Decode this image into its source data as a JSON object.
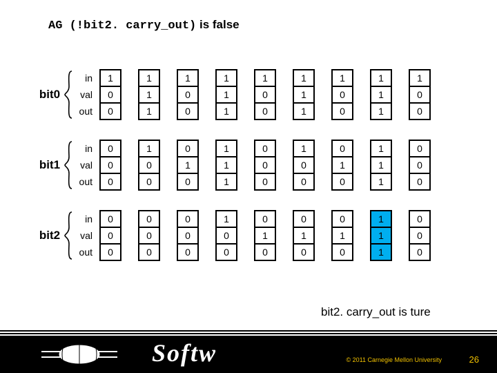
{
  "headline": {
    "code": "AG (!bit2. carry_out)",
    "suffix": " is false"
  },
  "groups": [
    {
      "label": "bit0",
      "rows": [
        "in",
        "val",
        "out"
      ],
      "columns": [
        [
          "1",
          "0",
          "0"
        ],
        [
          "1",
          "1",
          "1"
        ],
        [
          "1",
          "0",
          "0"
        ],
        [
          "1",
          "1",
          "1"
        ],
        [
          "1",
          "0",
          "0"
        ],
        [
          "1",
          "1",
          "1"
        ],
        [
          "1",
          "0",
          "0"
        ],
        [
          "1",
          "1",
          "1"
        ],
        [
          "1",
          "0",
          "0"
        ]
      ]
    },
    {
      "label": "bit1",
      "rows": [
        "in",
        "val",
        "out"
      ],
      "columns": [
        [
          "0",
          "0",
          "0"
        ],
        [
          "1",
          "0",
          "0"
        ],
        [
          "0",
          "1",
          "0"
        ],
        [
          "1",
          "1",
          "1"
        ],
        [
          "0",
          "0",
          "0"
        ],
        [
          "1",
          "0",
          "0"
        ],
        [
          "0",
          "1",
          "0"
        ],
        [
          "1",
          "1",
          "1"
        ],
        [
          "0",
          "0",
          "0"
        ]
      ]
    },
    {
      "label": "bit2",
      "rows": [
        "in",
        "val",
        "out"
      ],
      "columns": [
        [
          "0",
          "0",
          "0"
        ],
        [
          "0",
          "0",
          "0"
        ],
        [
          "0",
          "0",
          "0"
        ],
        [
          "1",
          "0",
          "0"
        ],
        [
          "0",
          "1",
          "0"
        ],
        [
          "0",
          "1",
          "0"
        ],
        [
          "0",
          "1",
          "0"
        ],
        [
          "1",
          "1",
          "1"
        ],
        [
          "0",
          "0",
          "0"
        ]
      ],
      "highlight_col": 7
    }
  ],
  "annotation": "bit2. carry_out is ture",
  "footer": {
    "brand": "Softw",
    "copyright": "© 2011 Carnegie Mellon University",
    "page": "26"
  },
  "chart_data": {
    "type": "table",
    "title": "AG (!bit2.carry_out) is false",
    "description": "State table for a 3-bit counter model checking example. 9 time steps (columns) × 3 bits × 3 signals (in, val, out). Column index 7 of bit2 is highlighted; annotation states bit2.carry_out is true at that step.",
    "steps": 9,
    "bits": [
      {
        "name": "bit0",
        "in": [
          1,
          1,
          1,
          1,
          1,
          1,
          1,
          1,
          1
        ],
        "val": [
          0,
          1,
          0,
          1,
          0,
          1,
          0,
          1,
          0
        ],
        "out": [
          0,
          1,
          0,
          1,
          0,
          1,
          0,
          1,
          0
        ]
      },
      {
        "name": "bit1",
        "in": [
          0,
          1,
          0,
          1,
          0,
          1,
          0,
          1,
          0
        ],
        "val": [
          0,
          0,
          1,
          1,
          0,
          0,
          1,
          1,
          0
        ],
        "out": [
          0,
          0,
          0,
          1,
          0,
          0,
          0,
          1,
          0
        ]
      },
      {
        "name": "bit2",
        "in": [
          0,
          0,
          0,
          1,
          0,
          0,
          0,
          1,
          0
        ],
        "val": [
          0,
          0,
          0,
          0,
          1,
          1,
          1,
          1,
          0
        ],
        "out": [
          0,
          0,
          0,
          0,
          0,
          0,
          0,
          1,
          0
        ]
      }
    ],
    "highlight": {
      "bit": "bit2",
      "step": 7
    },
    "annotation": "bit2.carry_out is true"
  }
}
